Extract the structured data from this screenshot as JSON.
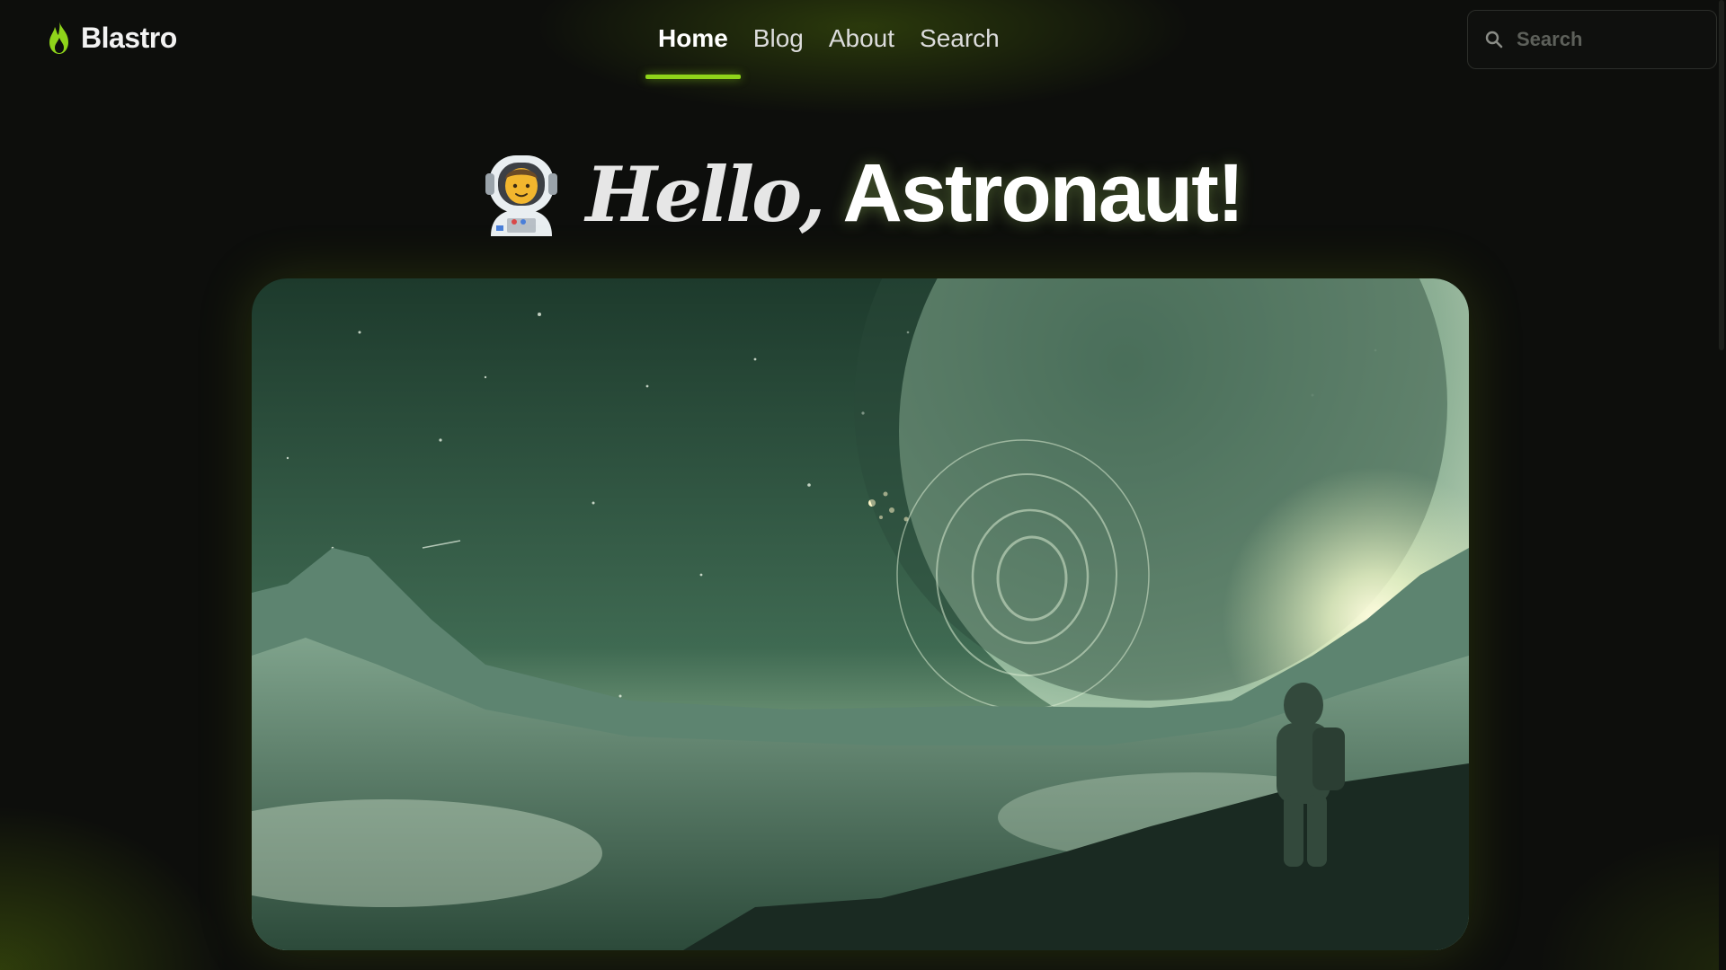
{
  "brand": {
    "name": "Blastro",
    "icon": "flame-icon",
    "accent": "#8fd41a"
  },
  "nav": {
    "items": [
      {
        "label": "Home",
        "active": true
      },
      {
        "label": "Blog",
        "active": false
      },
      {
        "label": "About",
        "active": false
      },
      {
        "label": "Search",
        "active": false
      }
    ]
  },
  "search": {
    "placeholder": "Search",
    "value": "",
    "icon": "search-icon"
  },
  "hero": {
    "emoji": "astronaut-emoji",
    "greeting": "Hello,",
    "name": "Astronaut!"
  },
  "hero_image": {
    "subject": "astronaut-planet-illustration"
  },
  "colors": {
    "background": "#0d0e0c",
    "accent": "#8fd41a",
    "text": "#ffffff"
  }
}
